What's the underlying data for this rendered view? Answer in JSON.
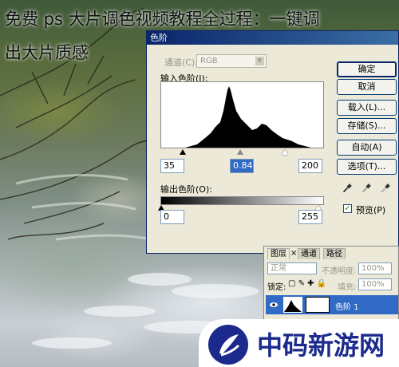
{
  "overlay_title": {
    "line1": "免费 ps 大片调色视频教程全过程：一键调",
    "line2": "出大片质感"
  },
  "levels_dialog": {
    "title": "色阶",
    "channel_label": "通道(C):",
    "channel_value": "RGB",
    "input_levels_label": "输入色阶(I):",
    "input_black": "35",
    "input_gamma": "0.84",
    "input_white": "200",
    "output_levels_label": "输出色阶(O):",
    "output_black": "0",
    "output_white": "255",
    "preview_label": "预览(P)",
    "preview_checked": true,
    "buttons": {
      "ok": "确定",
      "cancel": "取消",
      "load": "载入(L)...",
      "save": "存储(S)...",
      "auto": "自动(A)",
      "options": "选项(T)..."
    }
  },
  "layers_panel": {
    "tabs": [
      "图层",
      "通道",
      "路径"
    ],
    "tab_close": "×",
    "blend_mode": "正常",
    "opacity_label": "不透明度:",
    "opacity_value": "100%",
    "lock_label": "锁定:",
    "fill_label": "填充:",
    "fill_value": "100%",
    "layer_name": "色阶 1"
  },
  "watermark": {
    "text": "中码新游网",
    "brand_color": "#1b2a8c"
  }
}
